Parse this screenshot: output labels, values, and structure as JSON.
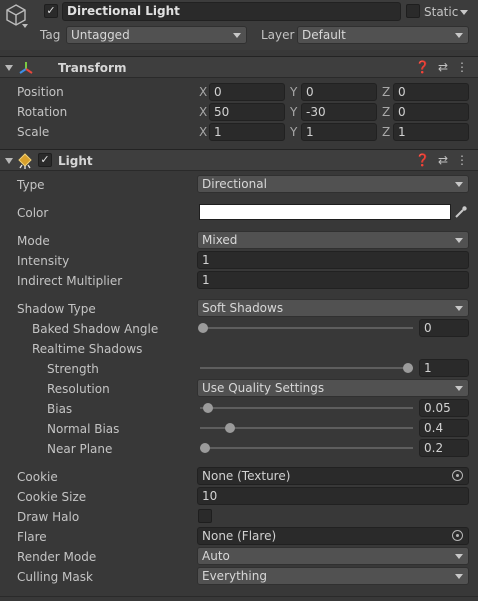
{
  "header": {
    "object_name": "Directional Light",
    "static_label": "Static",
    "tag_label": "Tag",
    "tag_value": "Untagged",
    "layer_label": "Layer",
    "layer_value": "Default"
  },
  "transform": {
    "title": "Transform",
    "position_label": "Position",
    "rotation_label": "Rotation",
    "scale_label": "Scale",
    "axis_x": "X",
    "axis_y": "Y",
    "axis_z": "Z",
    "position": {
      "x": "0",
      "y": "0",
      "z": "0"
    },
    "rotation": {
      "x": "50",
      "y": "-30",
      "z": "0"
    },
    "scale": {
      "x": "1",
      "y": "1",
      "z": "1"
    }
  },
  "light": {
    "title": "Light",
    "type_label": "Type",
    "type_value": "Directional",
    "color_label": "Color",
    "color_value": "#ffffff",
    "mode_label": "Mode",
    "mode_value": "Mixed",
    "intensity_label": "Intensity",
    "intensity_value": "1",
    "indirect_label": "Indirect Multiplier",
    "indirect_value": "1",
    "shadow_type_label": "Shadow Type",
    "shadow_type_value": "Soft Shadows",
    "baked_angle_label": "Baked Shadow Angle",
    "baked_angle_value": "0",
    "realtime_label": "Realtime Shadows",
    "strength_label": "Strength",
    "strength_value": "1",
    "resolution_label": "Resolution",
    "resolution_value": "Use Quality Settings",
    "bias_label": "Bias",
    "bias_value": "0.05",
    "normal_bias_label": "Normal Bias",
    "normal_bias_value": "0.4",
    "near_plane_label": "Near Plane",
    "near_plane_value": "0.2",
    "cookie_label": "Cookie",
    "cookie_value": "None (Texture)",
    "cookie_size_label": "Cookie Size",
    "cookie_size_value": "10",
    "draw_halo_label": "Draw Halo",
    "flare_label": "Flare",
    "flare_value": "None (Flare)",
    "render_mode_label": "Render Mode",
    "render_mode_value": "Auto",
    "culling_mask_label": "Culling Mask",
    "culling_mask_value": "Everything"
  },
  "icons": {
    "object": "cube-icon",
    "transform": "transform-axes-icon",
    "light": "light-icon",
    "help": "help-icon",
    "presets": "sliders-icon",
    "menu": "kebab-menu-icon"
  }
}
